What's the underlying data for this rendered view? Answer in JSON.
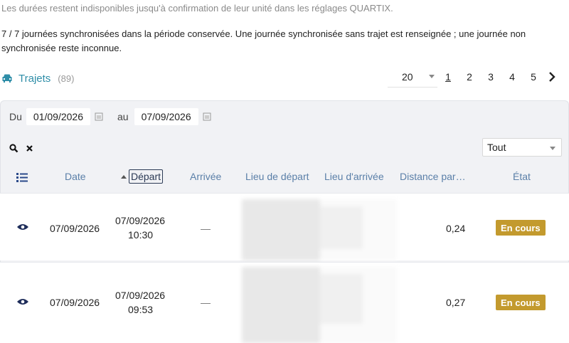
{
  "notes": {
    "top": "Les durées restent indisponibles jusqu'à confirmation de leur unité dans les réglages QUARTIX.",
    "sync": "7 / 7 journées synchronisées dans la période conservée. Une journée synchronisée sans trajet est renseignée ; une journée non synchronisée reste inconnue."
  },
  "trips": {
    "title": "Trajets",
    "count": "(89)",
    "icon": "car-icon"
  },
  "pager": {
    "page_size": "20",
    "pages": [
      "1",
      "2",
      "3",
      "4",
      "5"
    ],
    "current_page": "1",
    "next_icon": "chevron-right-icon"
  },
  "filters": {
    "from_label": "Du",
    "from_value": "01/09/2026",
    "to_label": "au",
    "to_value": "07/09/2026",
    "status_selected": "Tout"
  },
  "columns": {
    "date": "Date",
    "departure": "Départ",
    "arrival": "Arrivée",
    "departure_place": "Lieu de départ",
    "arrival_place": "Lieu d'arrivée",
    "distance": "Distance par…",
    "state": "État"
  },
  "rows": [
    {
      "date": "07/09/2026",
      "departure_date": "07/09/2026",
      "departure_time": "10:30",
      "arrival": "—",
      "distance": "0,24",
      "state": "En cours"
    },
    {
      "date": "07/09/2026",
      "departure_date": "07/09/2026",
      "departure_time": "09:53",
      "arrival": "—",
      "distance": "0,27",
      "state": "En cours"
    }
  ],
  "colors": {
    "accent": "#2f8ea8",
    "header_text": "#5a7fa8",
    "status_in_progress": "#c39a2e",
    "panel_bg": "#f1f2f5"
  }
}
